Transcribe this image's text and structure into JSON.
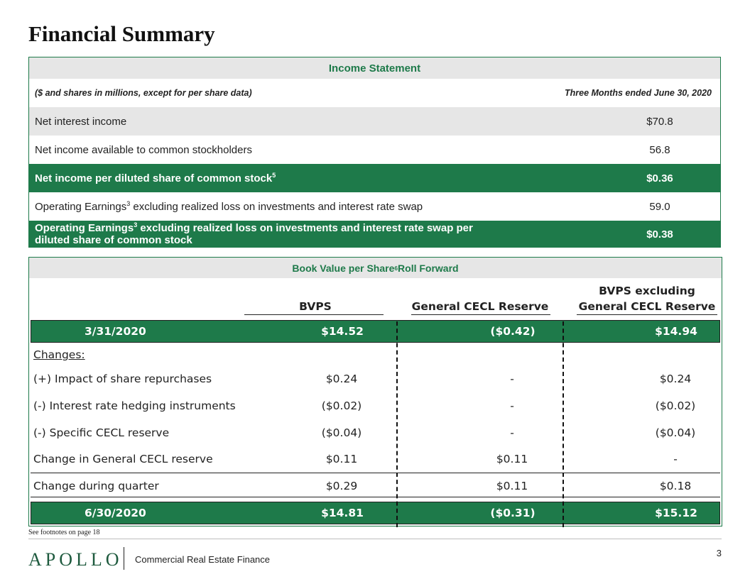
{
  "page": {
    "title": "Financial Summary",
    "page_number": "3",
    "footnote": "See footnotes on page 18"
  },
  "brand": {
    "logo": "APOLLO",
    "division": "Commercial Real Estate Finance"
  },
  "income_statement": {
    "header": "Income Statement",
    "units_note": "($ and shares in millions, except for per share data)",
    "period": "Three Months ended June 30, 2020",
    "rows": [
      {
        "label": "Net interest income",
        "value": "$70.8"
      },
      {
        "label": "Net income available to common stockholders",
        "value": "56.8"
      },
      {
        "label": "Net income per diluted share of common stock",
        "sup": "5",
        "value": "$0.36"
      },
      {
        "label_a": "Operating Earnings",
        "sup": "3",
        "label_b": " excluding realized loss on investments and interest rate swap",
        "value": "59.0"
      },
      {
        "label_a": "Operating Earnings",
        "sup": "3",
        "label_b": " excluding realized loss on investments and interest rate swap per",
        "label_c": "diluted share of common stock",
        "value": "$0.38"
      }
    ]
  },
  "book_value": {
    "header_a": "Book Value per Share",
    "header_sup": "6",
    "header_b": " Roll Forward",
    "columns": [
      "BVPS",
      "General CECL Reserve",
      "BVPS excluding",
      "General CECL Reserve"
    ],
    "rows": [
      {
        "label": "3/31/2020",
        "bvps": "$14.52",
        "cecl": "($0.42)",
        "excl": "$14.94"
      },
      {
        "label": "Changes:",
        "bvps": "",
        "cecl": "",
        "excl": ""
      },
      {
        "label": "(+) Impact of share repurchases",
        "bvps": "$0.24",
        "cecl": "-",
        "excl": "$0.24"
      },
      {
        "label": "(-)  Interest rate hedging instruments",
        "bvps": "($0.02)",
        "cecl": "-",
        "excl": "($0.02)"
      },
      {
        "label": "(-)  Specific CECL reserve",
        "bvps": "($0.04)",
        "cecl": "-",
        "excl": "($0.04)"
      },
      {
        "label": "Change in General CECL reserve",
        "bvps": "$0.11",
        "cecl": "$0.11",
        "excl": "-"
      },
      {
        "label": "Change during quarter",
        "bvps": "$0.29",
        "cecl": "$0.11",
        "excl": "$0.18"
      },
      {
        "label": "6/30/2020",
        "bvps": "$14.81",
        "cecl": "($0.31)",
        "excl": "$15.12"
      }
    ]
  },
  "colors": {
    "accent_green": "#1e7a4a",
    "header_gray": "#e6e6e6"
  }
}
